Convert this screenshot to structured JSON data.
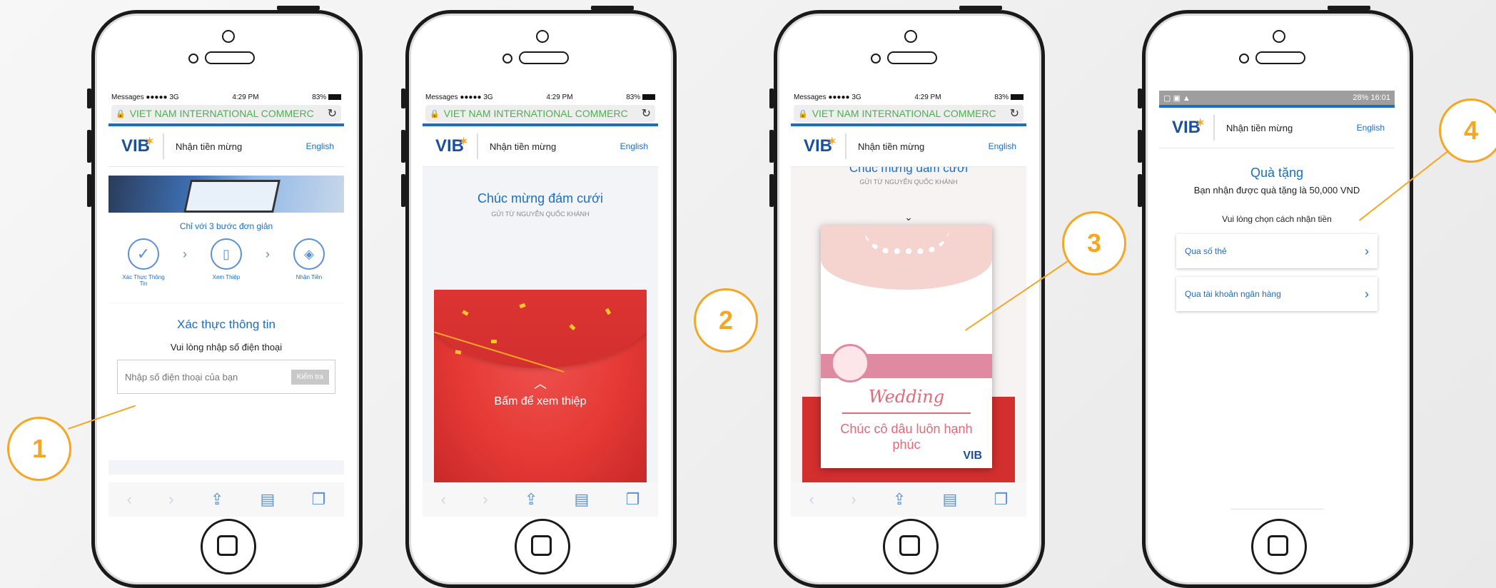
{
  "status_bar": {
    "left": "Messages ●●●●● 3G",
    "time": "4:29 PM",
    "right": "83%"
  },
  "url": "VIET NAM INTERNATIONAL COMMERC",
  "header": {
    "logo": "VIB",
    "title": "Nhận tiền mừng",
    "lang": "English"
  },
  "screen1": {
    "steps_caption": "Chỉ với 3 bước đơn giản",
    "steps": [
      {
        "label": "Xác Thực Thông Tin"
      },
      {
        "label": "Xem Thiệp"
      },
      {
        "label": "Nhận Tiền"
      }
    ],
    "verify_title": "Xác thực thông tin",
    "verify_prompt": "Vui lòng nhập số điện thoại",
    "phone_placeholder": "Nhập số điện thoại của bạn",
    "check_button": "Kiểm tra"
  },
  "screen2": {
    "title": "Chúc mừng đám cưới",
    "sender": "GỬI TỪ NGUYỄN QUỐC KHÁNH",
    "envelope_cta": "Bấm để xem thiệp"
  },
  "screen3": {
    "title": "Chúc mừng đám cưới",
    "sender": "GỬI TỪ NGUYỄN QUỐC KHÁNH",
    "card_script": "Wedding",
    "card_message": "Chúc cô dâu luôn hạnh phúc",
    "card_logo": "VIB"
  },
  "screen4": {
    "android_status": "28% 16:01",
    "gift_title": "Quà tặng",
    "gift_text": "Bạn nhận được quà tặng là 50,000 VND",
    "choose_text": "Vui lòng chọn cách nhận tiền",
    "options": [
      {
        "label": "Qua số thẻ"
      },
      {
        "label": "Qua tài khoản ngân hàng"
      }
    ]
  },
  "callouts": [
    "1",
    "2",
    "3",
    "4"
  ],
  "colors": {
    "accent": "#f5a623",
    "brand_blue": "#1b6ec2",
    "envelope_red": "#e53935"
  }
}
